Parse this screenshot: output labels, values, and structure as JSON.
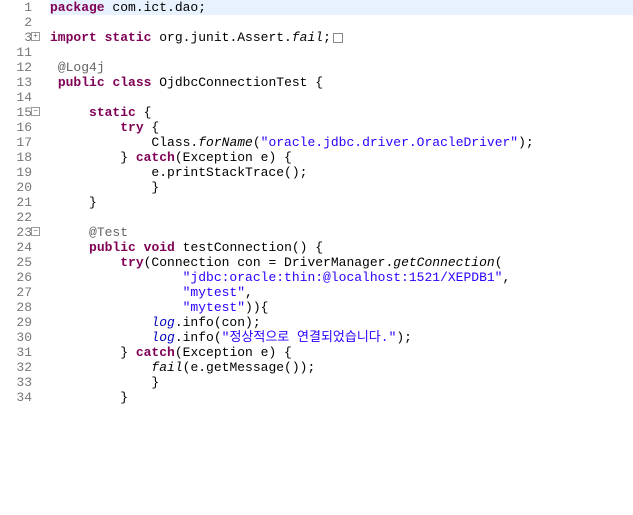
{
  "lines": [
    {
      "num": "1",
      "fold": "",
      "highlight": true,
      "tokens": [
        {
          "t": "package",
          "c": "kw"
        },
        {
          "t": " com.ict.dao;",
          "c": ""
        }
      ]
    },
    {
      "num": "2",
      "fold": "",
      "tokens": []
    },
    {
      "num": "3",
      "fold": "+",
      "tokens": [
        {
          "t": "import",
          "c": "kw"
        },
        {
          "t": " ",
          "c": ""
        },
        {
          "t": "static",
          "c": "kw"
        },
        {
          "t": " org.junit.Assert.",
          "c": ""
        },
        {
          "t": "fail",
          "c": "static-m"
        },
        {
          "t": ";",
          "c": ""
        },
        {
          "t": "BOX",
          "c": "box"
        }
      ]
    },
    {
      "num": "11",
      "fold": "",
      "tokens": []
    },
    {
      "num": "12",
      "fold": "",
      "tokens": [
        {
          "t": " ",
          "c": ""
        },
        {
          "t": "@Log4j",
          "c": "ann"
        }
      ]
    },
    {
      "num": "13",
      "fold": "",
      "tokens": [
        {
          "t": " ",
          "c": ""
        },
        {
          "t": "public",
          "c": "kw"
        },
        {
          "t": " ",
          "c": ""
        },
        {
          "t": "class",
          "c": "kw"
        },
        {
          "t": " OjdbcConnectionTest {",
          "c": ""
        }
      ]
    },
    {
      "num": "14",
      "fold": "",
      "tokens": []
    },
    {
      "num": "15",
      "fold": "-",
      "tokens": [
        {
          "t": "     ",
          "c": ""
        },
        {
          "t": "static",
          "c": "kw"
        },
        {
          "t": " {",
          "c": ""
        }
      ]
    },
    {
      "num": "16",
      "fold": "",
      "tokens": [
        {
          "t": "         ",
          "c": ""
        },
        {
          "t": "try",
          "c": "kw"
        },
        {
          "t": " {",
          "c": ""
        }
      ]
    },
    {
      "num": "17",
      "fold": "",
      "tokens": [
        {
          "t": "             Class.",
          "c": ""
        },
        {
          "t": "forName",
          "c": "static-m"
        },
        {
          "t": "(",
          "c": ""
        },
        {
          "t": "\"oracle.jdbc.driver.OracleDriver\"",
          "c": "str"
        },
        {
          "t": ");",
          "c": ""
        }
      ]
    },
    {
      "num": "18",
      "fold": "",
      "tokens": [
        {
          "t": "         } ",
          "c": ""
        },
        {
          "t": "catch",
          "c": "kw"
        },
        {
          "t": "(Exception e) {",
          "c": ""
        }
      ]
    },
    {
      "num": "19",
      "fold": "",
      "tokens": [
        {
          "t": "             e.printStackTrace();",
          "c": ""
        }
      ]
    },
    {
      "num": "20",
      "fold": "",
      "tokens": [
        {
          "t": "             }",
          "c": ""
        }
      ]
    },
    {
      "num": "21",
      "fold": "",
      "tokens": [
        {
          "t": "     }",
          "c": ""
        }
      ]
    },
    {
      "num": "22",
      "fold": "",
      "tokens": []
    },
    {
      "num": "23",
      "fold": "-",
      "tokens": [
        {
          "t": "     ",
          "c": ""
        },
        {
          "t": "@Test",
          "c": "ann"
        }
      ]
    },
    {
      "num": "24",
      "fold": "",
      "tokens": [
        {
          "t": "     ",
          "c": ""
        },
        {
          "t": "public",
          "c": "kw"
        },
        {
          "t": " ",
          "c": ""
        },
        {
          "t": "void",
          "c": "kw"
        },
        {
          "t": " testConnection() {",
          "c": ""
        }
      ]
    },
    {
      "num": "25",
      "fold": "",
      "tokens": [
        {
          "t": "         ",
          "c": ""
        },
        {
          "t": "try",
          "c": "kw"
        },
        {
          "t": "(Connection con = DriverManager.",
          "c": ""
        },
        {
          "t": "getConnection",
          "c": "static-m"
        },
        {
          "t": "(",
          "c": ""
        }
      ]
    },
    {
      "num": "26",
      "fold": "",
      "tokens": [
        {
          "t": "                 ",
          "c": ""
        },
        {
          "t": "\"jdbc:oracle:thin:@localhost:1521/XEPDB1\"",
          "c": "str"
        },
        {
          "t": ",",
          "c": ""
        }
      ]
    },
    {
      "num": "27",
      "fold": "",
      "tokens": [
        {
          "t": "                 ",
          "c": ""
        },
        {
          "t": "\"mytest\"",
          "c": "str"
        },
        {
          "t": ",",
          "c": ""
        }
      ]
    },
    {
      "num": "28",
      "fold": "",
      "tokens": [
        {
          "t": "                 ",
          "c": ""
        },
        {
          "t": "\"mytest\"",
          "c": "str"
        },
        {
          "t": ")){",
          "c": ""
        }
      ]
    },
    {
      "num": "29",
      "fold": "",
      "tokens": [
        {
          "t": "             ",
          "c": ""
        },
        {
          "t": "log",
          "c": "field"
        },
        {
          "t": ".info(con);",
          "c": ""
        }
      ]
    },
    {
      "num": "30",
      "fold": "",
      "tokens": [
        {
          "t": "             ",
          "c": ""
        },
        {
          "t": "log",
          "c": "field"
        },
        {
          "t": ".info(",
          "c": ""
        },
        {
          "t": "\"정상적으로 연결되었습니다.\"",
          "c": "str"
        },
        {
          "t": ");",
          "c": ""
        }
      ]
    },
    {
      "num": "31",
      "fold": "",
      "tokens": [
        {
          "t": "         } ",
          "c": ""
        },
        {
          "t": "catch",
          "c": "kw"
        },
        {
          "t": "(Exception e) {",
          "c": ""
        }
      ]
    },
    {
      "num": "32",
      "fold": "",
      "tokens": [
        {
          "t": "             ",
          "c": ""
        },
        {
          "t": "fail",
          "c": "static-m"
        },
        {
          "t": "(e.getMessage());",
          "c": ""
        }
      ]
    },
    {
      "num": "33",
      "fold": "",
      "tokens": [
        {
          "t": "             }",
          "c": ""
        }
      ]
    },
    {
      "num": "34",
      "fold": "",
      "tokens": [
        {
          "t": "         }",
          "c": ""
        }
      ]
    }
  ]
}
